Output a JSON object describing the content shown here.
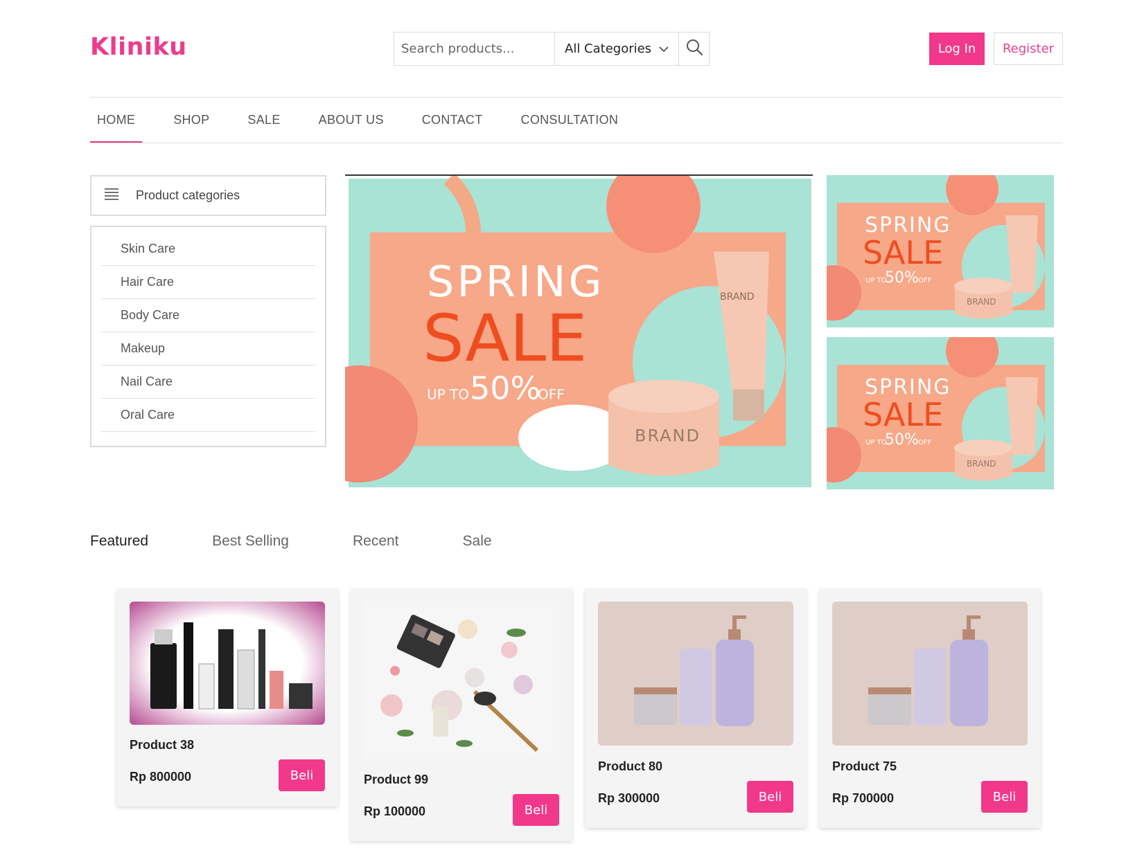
{
  "brand": {
    "name": "Kliniku",
    "accent": "#ec3d8d"
  },
  "search": {
    "placeholder": "Search products...",
    "value": "",
    "category_selected": "All Categories"
  },
  "auth": {
    "login_label": "Log In",
    "register_label": "Register"
  },
  "nav": {
    "items": [
      "HOME",
      "SHOP",
      "SALE",
      "ABOUT US",
      "CONTACT",
      "CONSULTATION"
    ],
    "active": "HOME"
  },
  "sidebar": {
    "title": "Product categories",
    "categories": [
      "Skin Care",
      "Hair Care",
      "Body Care",
      "Makeup",
      "Nail Care",
      "Oral Care"
    ]
  },
  "banners": {
    "main": {
      "line1": "SPRING",
      "line2": "SALE",
      "prefix": "UP TO",
      "discount": "50%",
      "suffix": "OFF",
      "product": "BRAND"
    },
    "small": {
      "line1": "SPRING",
      "line2": "SALE",
      "prefix": "UP TO",
      "discount": "50%",
      "suffix": "OFF",
      "product": "BRAND"
    }
  },
  "tabs": {
    "items": [
      "Featured",
      "Best Selling",
      "Recent",
      "Sale"
    ],
    "active": "Featured"
  },
  "products": [
    {
      "name": "Product 38",
      "price": "Rp 800000",
      "buy_label": "Beli"
    },
    {
      "name": "Product 99",
      "price": "Rp 100000",
      "buy_label": "Beli"
    },
    {
      "name": "Product 80",
      "price": "Rp 300000",
      "buy_label": "Beli"
    },
    {
      "name": "Product 75",
      "price": "Rp 700000",
      "buy_label": "Beli"
    }
  ]
}
